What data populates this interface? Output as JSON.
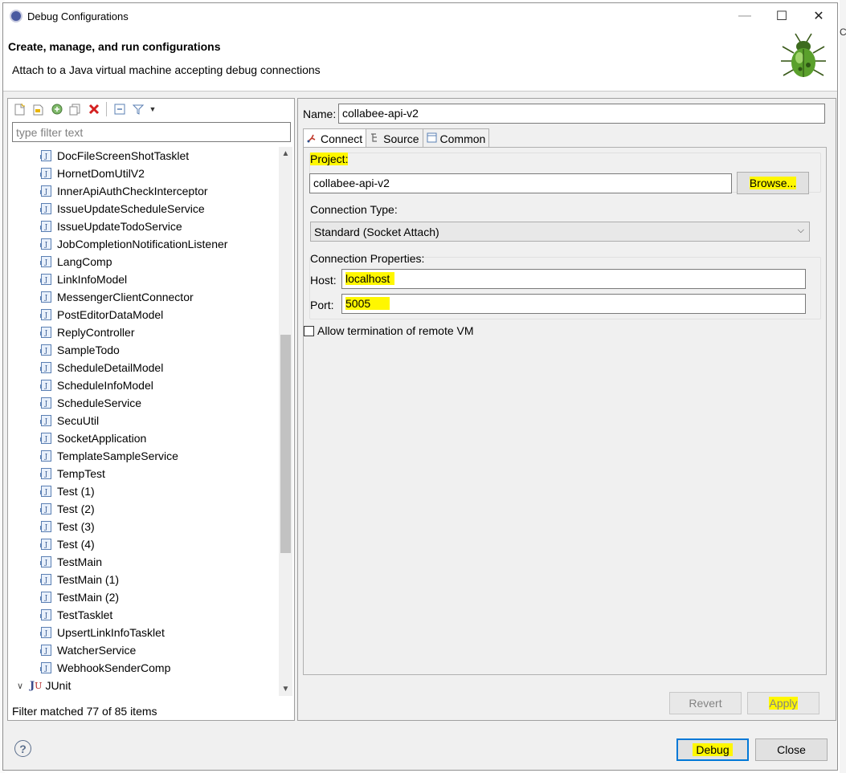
{
  "window": {
    "title": "Debug Configurations",
    "controls": {
      "minimize": "—",
      "maximize": "☐",
      "close": "✕"
    }
  },
  "header": {
    "title": "Create, manage, and run configurations",
    "description": "Attach to a Java virtual machine accepting debug connections"
  },
  "left": {
    "filter_placeholder": "type filter text",
    "filter_value": "",
    "tree_items": [
      "DocFileScreenShotTasklet",
      "HornetDomUtilV2",
      "InnerApiAuthCheckInterceptor",
      "IssueUpdateScheduleService",
      "IssueUpdateTodoService",
      "JobCompletionNotificationListener",
      "LangComp",
      "LinkInfoModel",
      "MessengerClientConnector",
      "PostEditorDataModel",
      "ReplyController",
      "SampleTodo",
      "ScheduleDetailModel",
      "ScheduleInfoModel",
      "ScheduleService",
      "SecuUtil",
      "SocketApplication",
      "TemplateSampleService",
      "TempTest",
      "Test (1)",
      "Test (2)",
      "Test (3)",
      "Test (4)",
      "TestMain",
      "TestMain (1)",
      "TestMain (2)",
      "TestTasklet",
      "UpsertLinkInfoTasklet",
      "WatcherService",
      "WebhookSenderComp"
    ],
    "group_label": "JUnit",
    "filter_status": "Filter matched 77 of 85 items"
  },
  "right": {
    "name_label": "Name:",
    "name_value": "collabee-api-v2",
    "tabs": [
      {
        "label": "Connect",
        "icon": "connect-icon"
      },
      {
        "label": "Source",
        "icon": "source-icon"
      },
      {
        "label": "Common",
        "icon": "common-icon"
      }
    ],
    "project": {
      "label": "Project:",
      "value": "collabee-api-v2",
      "browse_label": "Browse..."
    },
    "connection_type": {
      "label": "Connection Type:",
      "value": "Standard (Socket Attach)"
    },
    "connection_properties": {
      "label": "Connection Properties:",
      "host_label": "Host:",
      "host_value": "localhost",
      "port_label": "Port:",
      "port_value": "5005"
    },
    "allow_termination_label": "Allow termination of remote VM",
    "revert_label": "Revert",
    "apply_label": "Apply"
  },
  "footer": {
    "help": "?",
    "debug_label": "Debug",
    "close_label": "Close"
  },
  "colors": {
    "highlight": "#fff700",
    "accent_border": "#0078d7"
  },
  "stray_right_text": "C"
}
